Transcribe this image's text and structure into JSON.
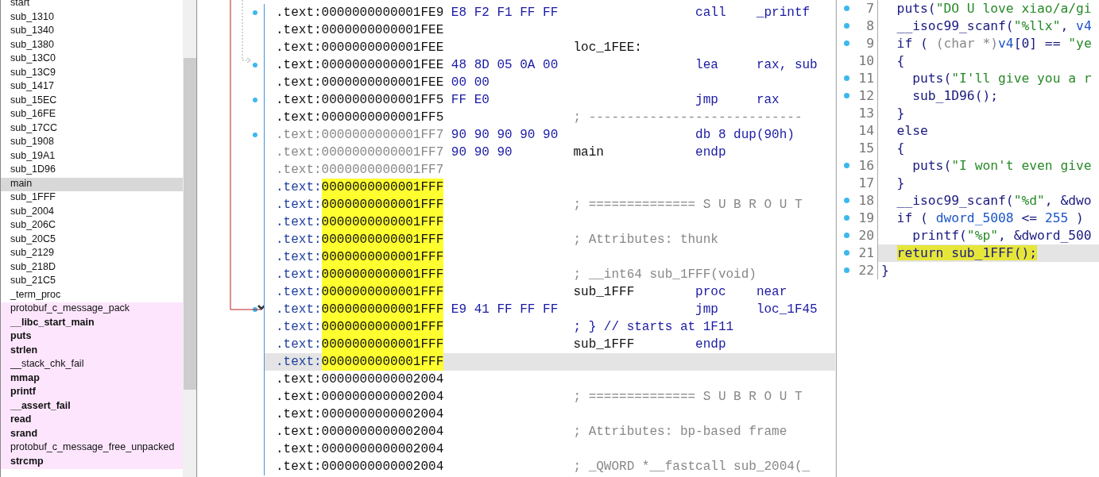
{
  "functions": {
    "items": [
      {
        "name": "start",
        "kind": "function",
        "bold": false,
        "selected": false
      },
      {
        "name": "sub_1310",
        "kind": "function",
        "bold": false,
        "selected": false
      },
      {
        "name": "sub_1340",
        "kind": "function",
        "bold": false,
        "selected": false
      },
      {
        "name": "sub_1380",
        "kind": "function",
        "bold": false,
        "selected": false
      },
      {
        "name": "sub_13C0",
        "kind": "function",
        "bold": false,
        "selected": false
      },
      {
        "name": "sub_13C9",
        "kind": "function",
        "bold": false,
        "selected": false
      },
      {
        "name": "sub_1417",
        "kind": "function",
        "bold": false,
        "selected": false
      },
      {
        "name": "sub_15EC",
        "kind": "function",
        "bold": false,
        "selected": false
      },
      {
        "name": "sub_16FE",
        "kind": "function",
        "bold": false,
        "selected": false
      },
      {
        "name": "sub_17CC",
        "kind": "function",
        "bold": false,
        "selected": false
      },
      {
        "name": "sub_1908",
        "kind": "function",
        "bold": false,
        "selected": false
      },
      {
        "name": "sub_19A1",
        "kind": "function",
        "bold": false,
        "selected": false
      },
      {
        "name": "sub_1D96",
        "kind": "function",
        "bold": false,
        "selected": false
      },
      {
        "name": "main",
        "kind": "function",
        "bold": false,
        "selected": true
      },
      {
        "name": "sub_1FFF",
        "kind": "function",
        "bold": false,
        "selected": false
      },
      {
        "name": "sub_2004",
        "kind": "function",
        "bold": false,
        "selected": false
      },
      {
        "name": "sub_206C",
        "kind": "function",
        "bold": false,
        "selected": false
      },
      {
        "name": "sub_20C5",
        "kind": "function",
        "bold": false,
        "selected": false
      },
      {
        "name": "sub_2129",
        "kind": "function",
        "bold": false,
        "selected": false
      },
      {
        "name": "sub_218D",
        "kind": "function",
        "bold": false,
        "selected": false
      },
      {
        "name": "sub_21C5",
        "kind": "function",
        "bold": false,
        "selected": false
      },
      {
        "name": "_term_proc",
        "kind": "function",
        "bold": false,
        "selected": false
      },
      {
        "name": "protobuf_c_message_pack",
        "kind": "import",
        "bold": false,
        "selected": false
      },
      {
        "name": "__libc_start_main",
        "kind": "import",
        "bold": true,
        "selected": false
      },
      {
        "name": "puts",
        "kind": "import",
        "bold": true,
        "selected": false
      },
      {
        "name": "strlen",
        "kind": "import",
        "bold": true,
        "selected": false
      },
      {
        "name": "__stack_chk_fail",
        "kind": "import",
        "bold": false,
        "selected": false
      },
      {
        "name": "mmap",
        "kind": "import",
        "bold": true,
        "selected": false
      },
      {
        "name": "printf",
        "kind": "import",
        "bold": true,
        "selected": false
      },
      {
        "name": "__assert_fail",
        "kind": "import",
        "bold": true,
        "selected": false
      },
      {
        "name": "read",
        "kind": "import",
        "bold": true,
        "selected": false
      },
      {
        "name": "srand",
        "kind": "import",
        "bold": true,
        "selected": false
      },
      {
        "name": "protobuf_c_message_free_unpacked",
        "kind": "import",
        "bold": false,
        "selected": false
      },
      {
        "name": "strcmp",
        "kind": "import",
        "bold": true,
        "selected": false
      }
    ]
  },
  "disassembly": {
    "rows": [
      {
        "segment": ".text:",
        "address": "0000000000001FE9",
        "kind": "normal",
        "address_highlighted": false,
        "selected": false,
        "breakpoint": true,
        "bytes": "E8 F2 F1 FF FF",
        "mnemonic": "call",
        "operands": "_printf"
      },
      {
        "segment": ".text:",
        "address": "0000000000001FEE",
        "kind": "normal",
        "address_highlighted": false,
        "selected": false,
        "breakpoint": false
      },
      {
        "segment": ".text:",
        "address": "0000000000001FEE",
        "kind": "normal",
        "address_highlighted": false,
        "selected": false,
        "breakpoint": false,
        "label": "loc_1FEE:"
      },
      {
        "segment": ".text:",
        "address": "0000000000001FEE",
        "kind": "normal",
        "address_highlighted": false,
        "selected": false,
        "breakpoint": true,
        "bytes": "48 8D 05 0A 00",
        "mnemonic": "lea",
        "operands": "rax, sub"
      },
      {
        "segment": ".text:",
        "address": "0000000000001FEE",
        "kind": "normal",
        "address_highlighted": false,
        "selected": false,
        "breakpoint": false,
        "bytes": "00 00"
      },
      {
        "segment": ".text:",
        "address": "0000000000001FF5",
        "kind": "normal",
        "address_highlighted": false,
        "selected": false,
        "breakpoint": true,
        "bytes": "FF E0",
        "mnemonic": "jmp",
        "operands": "rax"
      },
      {
        "segment": ".text:",
        "address": "0000000000001FF5",
        "kind": "normal",
        "address_highlighted": false,
        "selected": false,
        "breakpoint": false,
        "comment": "; ----------------------------"
      },
      {
        "segment": ".text:",
        "address": "0000000000001FF7",
        "kind": "dim",
        "address_highlighted": false,
        "selected": false,
        "breakpoint": true,
        "bytes": "90 90 90 90 90",
        "mnemonic": "db 8 dup(90h)"
      },
      {
        "segment": ".text:",
        "address": "0000000000001FF7",
        "kind": "dim",
        "address_highlighted": false,
        "selected": false,
        "breakpoint": false,
        "bytes": "90 90 90",
        "label": "main",
        "mnemonic": "endp"
      },
      {
        "segment": ".text:",
        "address": "0000000000001FF7",
        "kind": "dim",
        "address_highlighted": false,
        "selected": false,
        "breakpoint": false
      },
      {
        "segment": ".text:",
        "address": "0000000000001FFF",
        "kind": "func",
        "address_highlighted": true,
        "selected": false,
        "breakpoint": false
      },
      {
        "segment": ".text:",
        "address": "0000000000001FFF",
        "kind": "func",
        "address_highlighted": true,
        "selected": false,
        "breakpoint": false,
        "comment": "; ============== S U B R O U T"
      },
      {
        "segment": ".text:",
        "address": "0000000000001FFF",
        "kind": "func",
        "address_highlighted": true,
        "selected": false,
        "breakpoint": false
      },
      {
        "segment": ".text:",
        "address": "0000000000001FFF",
        "kind": "func",
        "address_highlighted": true,
        "selected": false,
        "breakpoint": false,
        "comment": "; Attributes: thunk"
      },
      {
        "segment": ".text:",
        "address": "0000000000001FFF",
        "kind": "func",
        "address_highlighted": true,
        "selected": false,
        "breakpoint": false
      },
      {
        "segment": ".text:",
        "address": "0000000000001FFF",
        "kind": "func",
        "address_highlighted": true,
        "selected": false,
        "breakpoint": false,
        "comment": "; __int64 sub_1FFF(void)"
      },
      {
        "segment": ".text:",
        "address": "0000000000001FFF",
        "kind": "func",
        "address_highlighted": true,
        "selected": false,
        "breakpoint": false,
        "label": "sub_1FFF",
        "mnemonic": "proc",
        "operands": "near"
      },
      {
        "segment": ".text:",
        "address": "0000000000001FFF",
        "kind": "func",
        "address_highlighted": true,
        "selected": false,
        "breakpoint": true,
        "bytes": "E9 41 FF FF FF",
        "mnemonic": "jmp",
        "operands": "loc_1F45"
      },
      {
        "segment": ".text:",
        "address": "0000000000001FFF",
        "kind": "func",
        "address_highlighted": true,
        "selected": false,
        "breakpoint": false,
        "note": "; } // starts at 1F11"
      },
      {
        "segment": ".text:",
        "address": "0000000000001FFF",
        "kind": "func",
        "address_highlighted": true,
        "selected": false,
        "breakpoint": false,
        "label": "sub_1FFF",
        "mnemonic": "endp"
      },
      {
        "segment": ".text:",
        "address": "0000000000001FFF",
        "kind": "func",
        "address_highlighted": true,
        "selected": true,
        "breakpoint": false
      },
      {
        "segment": ".text:",
        "address": "0000000000002004",
        "kind": "normal",
        "address_highlighted": false,
        "selected": false,
        "breakpoint": false
      },
      {
        "segment": ".text:",
        "address": "0000000000002004",
        "kind": "normal",
        "address_highlighted": false,
        "selected": false,
        "breakpoint": false,
        "comment": "; ============== S U B R O U T"
      },
      {
        "segment": ".text:",
        "address": "0000000000002004",
        "kind": "normal",
        "address_highlighted": false,
        "selected": false,
        "breakpoint": false
      },
      {
        "segment": ".text:",
        "address": "0000000000002004",
        "kind": "normal",
        "address_highlighted": false,
        "selected": false,
        "breakpoint": false,
        "comment": "; Attributes: bp-based frame"
      },
      {
        "segment": ".text:",
        "address": "0000000000002004",
        "kind": "normal",
        "address_highlighted": false,
        "selected": false,
        "breakpoint": false
      },
      {
        "segment": ".text:",
        "address": "0000000000002004",
        "kind": "normal",
        "address_highlighted": false,
        "selected": false,
        "breakpoint": false,
        "comment": "; _QWORD *__fastcall sub_2004(_"
      }
    ]
  },
  "pseudocode": {
    "lines": [
      {
        "number": "7",
        "breakpoint": true,
        "selected": false,
        "tokens": [
          {
            "text": "  puts(",
            "kind": "code"
          },
          {
            "text": "\"DO U love xiao/a/gi",
            "kind": "string"
          }
        ]
      },
      {
        "number": "8",
        "breakpoint": true,
        "selected": false,
        "tokens": [
          {
            "text": "  __isoc99_scanf(",
            "kind": "code"
          },
          {
            "text": "\"%llx\"",
            "kind": "string"
          },
          {
            "text": ", ",
            "kind": "code"
          },
          {
            "text": "v4",
            "kind": "var"
          }
        ]
      },
      {
        "number": "9",
        "breakpoint": true,
        "selected": false,
        "tokens": [
          {
            "text": "  if ( ",
            "kind": "code"
          },
          {
            "text": "(char *)",
            "kind": "cast"
          },
          {
            "text": "v4",
            "kind": "var"
          },
          {
            "text": "[0] == ",
            "kind": "code"
          },
          {
            "text": "\"ye",
            "kind": "string"
          }
        ]
      },
      {
        "number": "10",
        "breakpoint": false,
        "selected": false,
        "tokens": [
          {
            "text": "  {",
            "kind": "code"
          }
        ]
      },
      {
        "number": "11",
        "breakpoint": true,
        "selected": false,
        "tokens": [
          {
            "text": "    puts(",
            "kind": "code"
          },
          {
            "text": "\"I'll give you a r",
            "kind": "string"
          }
        ]
      },
      {
        "number": "12",
        "breakpoint": true,
        "selected": false,
        "tokens": [
          {
            "text": "    sub_1D96();",
            "kind": "code"
          }
        ]
      },
      {
        "number": "13",
        "breakpoint": false,
        "selected": false,
        "tokens": [
          {
            "text": "  }",
            "kind": "code"
          }
        ]
      },
      {
        "number": "14",
        "breakpoint": false,
        "selected": false,
        "tokens": [
          {
            "text": "  else",
            "kind": "code"
          }
        ]
      },
      {
        "number": "15",
        "breakpoint": false,
        "selected": false,
        "tokens": [
          {
            "text": "  {",
            "kind": "code"
          }
        ]
      },
      {
        "number": "16",
        "breakpoint": true,
        "selected": false,
        "tokens": [
          {
            "text": "    puts(",
            "kind": "code"
          },
          {
            "text": "\"I won't even give",
            "kind": "string"
          }
        ]
      },
      {
        "number": "17",
        "breakpoint": false,
        "selected": false,
        "tokens": [
          {
            "text": "  }",
            "kind": "code"
          }
        ]
      },
      {
        "number": "18",
        "breakpoint": true,
        "selected": false,
        "tokens": [
          {
            "text": "  __isoc99_scanf(",
            "kind": "code"
          },
          {
            "text": "\"%d\"",
            "kind": "string"
          },
          {
            "text": ", &dwo",
            "kind": "code"
          }
        ]
      },
      {
        "number": "19",
        "breakpoint": true,
        "selected": false,
        "tokens": [
          {
            "text": "  if ( ",
            "kind": "code"
          },
          {
            "text": "dword_5008",
            "kind": "var"
          },
          {
            "text": " <= ",
            "kind": "code"
          },
          {
            "text": "255",
            "kind": "var"
          },
          {
            "text": " )",
            "kind": "code"
          }
        ]
      },
      {
        "number": "20",
        "breakpoint": true,
        "selected": false,
        "tokens": [
          {
            "text": "    printf(",
            "kind": "code"
          },
          {
            "text": "\"%p\"",
            "kind": "string"
          },
          {
            "text": ", &dword_500",
            "kind": "code"
          }
        ]
      },
      {
        "number": "21",
        "breakpoint": true,
        "selected": true,
        "tokens": [
          {
            "text": "return sub_1FFF();",
            "kind": "highlight"
          }
        ]
      },
      {
        "number": "22",
        "breakpoint": true,
        "selected": false,
        "tokens": [
          {
            "text": "}",
            "kind": "code"
          }
        ]
      }
    ]
  }
}
